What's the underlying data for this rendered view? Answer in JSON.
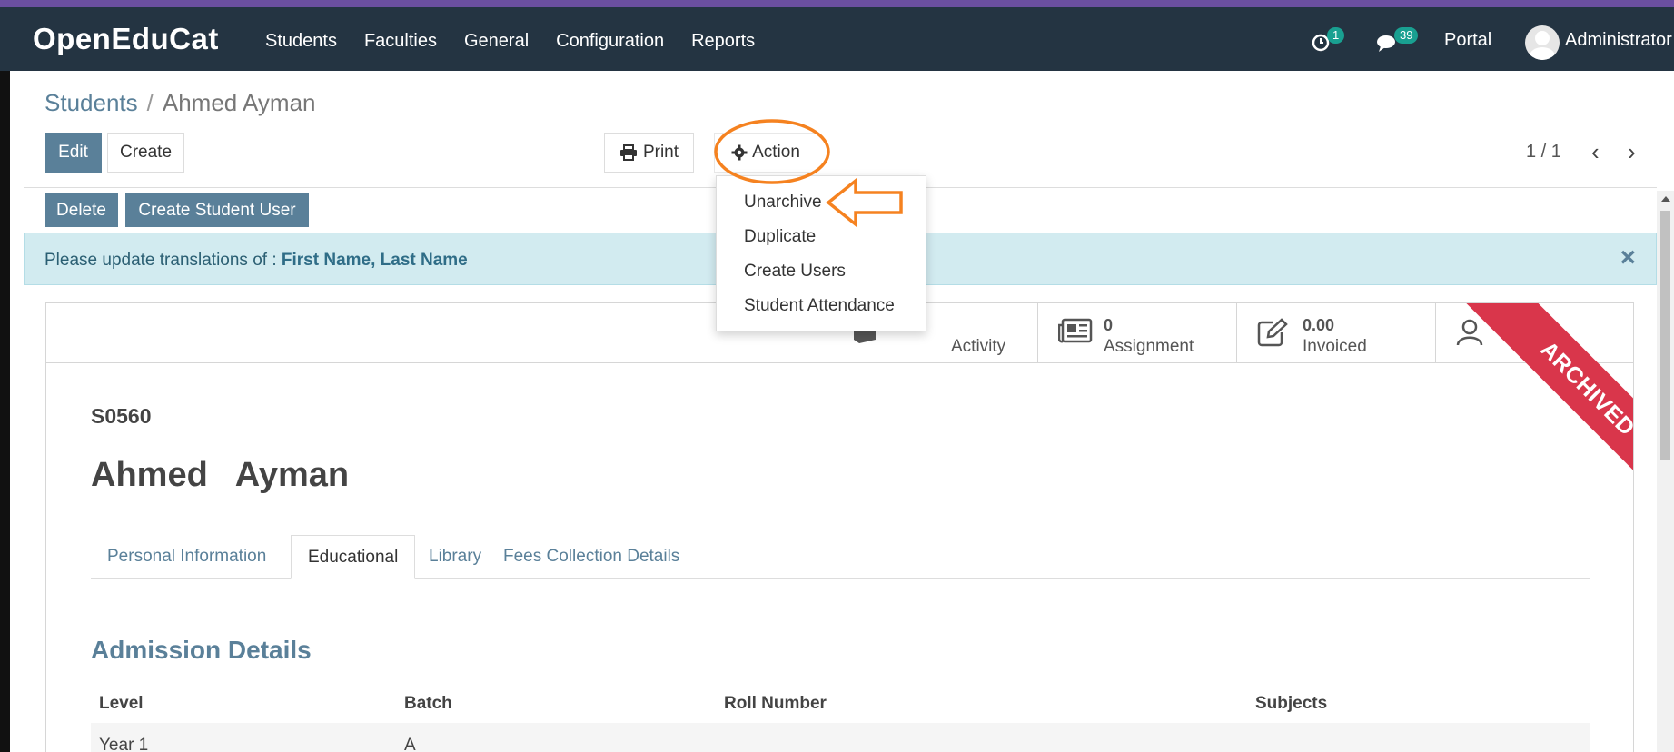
{
  "brand": "OpenEduCat",
  "menu": [
    "Students",
    "Faculties",
    "General",
    "Configuration",
    "Reports"
  ],
  "systray": {
    "activity_count": "1",
    "messages_count": "39",
    "portal": "Portal",
    "user": "Administrator"
  },
  "breadcrumb": {
    "parent": "Students",
    "separator": "/",
    "current": "Ahmed Ayman"
  },
  "buttons": {
    "edit": "Edit",
    "create": "Create",
    "print": "Print",
    "action": "Action",
    "delete": "Delete",
    "create_student_user": "Create Student User"
  },
  "pager": {
    "value": "1 / 1"
  },
  "action_menu": [
    "Unarchive",
    "Duplicate",
    "Create Users",
    "Student Attendance"
  ],
  "alert": {
    "text": "Please update translations of : ",
    "fields": "First Name, Last Name",
    "close": "×"
  },
  "stat_buttons": [
    {
      "value": "",
      "label": "Activity",
      "icon": "book-icon"
    },
    {
      "value": "0",
      "label": "Assignment",
      "icon": "newspaper-icon"
    },
    {
      "value": "0.00",
      "label": "Invoiced",
      "icon": "edit-icon"
    },
    {
      "value": "",
      "label": "",
      "icon": "user-icon"
    }
  ],
  "ribbon": "ARCHIVED",
  "record": {
    "code": "S0560",
    "first_name": "Ahmed",
    "last_name": "Ayman"
  },
  "tabs": [
    "Personal Information",
    "Educational",
    "Library",
    "Fees Collection Details"
  ],
  "active_tab": "Educational",
  "section_title": "Admission Details",
  "table": {
    "headers": [
      "Level",
      "Batch",
      "Roll Number",
      "Subjects"
    ],
    "rows": [
      [
        "Year 1",
        "A",
        "",
        ""
      ]
    ]
  },
  "colors": {
    "navbar": "#243442",
    "primary": "#5a8099",
    "ribbon": "#d9364b",
    "annotation": "#f58220",
    "badge": "#19a091"
  }
}
